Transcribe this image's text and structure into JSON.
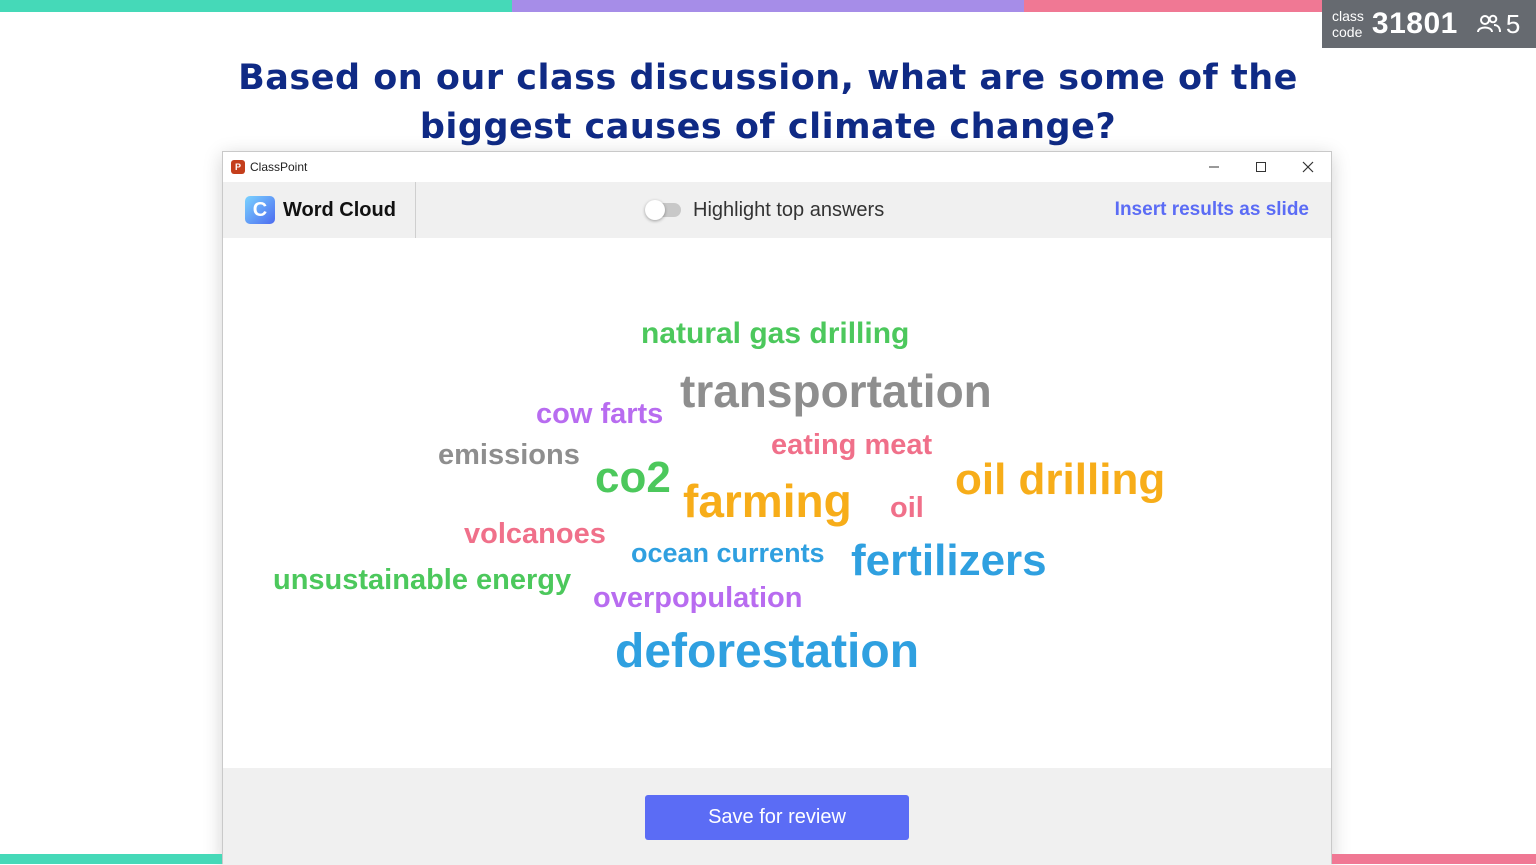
{
  "colors": {
    "top_bar": [
      "#45d9b8",
      "#a68de8",
      "#f07894"
    ],
    "question": "#0f2a85",
    "accent": "#5b6cf5"
  },
  "class_code": {
    "label_line1": "class",
    "label_line2": "code",
    "number": "31801",
    "participants": "5",
    "icon": "people-icon"
  },
  "question": {
    "line1": "Based on our class discussion, what are some of the",
    "line2": "biggest causes of climate change?"
  },
  "window": {
    "title": "ClassPoint",
    "icon": "powerpoint-icon",
    "minimize": "—",
    "maximize": "☐",
    "close": "✕"
  },
  "toolbar": {
    "title": "Word Cloud",
    "logo_letter": "C",
    "toggle_label": "Highlight top answers",
    "insert_link": "Insert results as slide"
  },
  "words": [
    {
      "text": "natural gas drilling",
      "color": "#4cc85c"
    },
    {
      "text": "transportation",
      "color": "#8e8e8e"
    },
    {
      "text": "cow farts",
      "color": "#b86cf0"
    },
    {
      "text": "eating meat",
      "color": "#f0708a"
    },
    {
      "text": "emissions",
      "color": "#8e8e8e"
    },
    {
      "text": "co2",
      "color": "#4cc85c"
    },
    {
      "text": "oil drilling",
      "color": "#f7ad19"
    },
    {
      "text": "farming",
      "color": "#f7ad19"
    },
    {
      "text": "oil",
      "color": "#f0708a"
    },
    {
      "text": "volcanoes",
      "color": "#f0708a"
    },
    {
      "text": "ocean currents",
      "color": "#2fa0e0"
    },
    {
      "text": "fertilizers",
      "color": "#2fa0e0"
    },
    {
      "text": "unsustainable energy",
      "color": "#4cc85c"
    },
    {
      "text": "overpopulation",
      "color": "#b86cf0"
    },
    {
      "text": "deforestation",
      "color": "#2fa0e0"
    }
  ],
  "footer": {
    "save_label": "Save for review"
  }
}
